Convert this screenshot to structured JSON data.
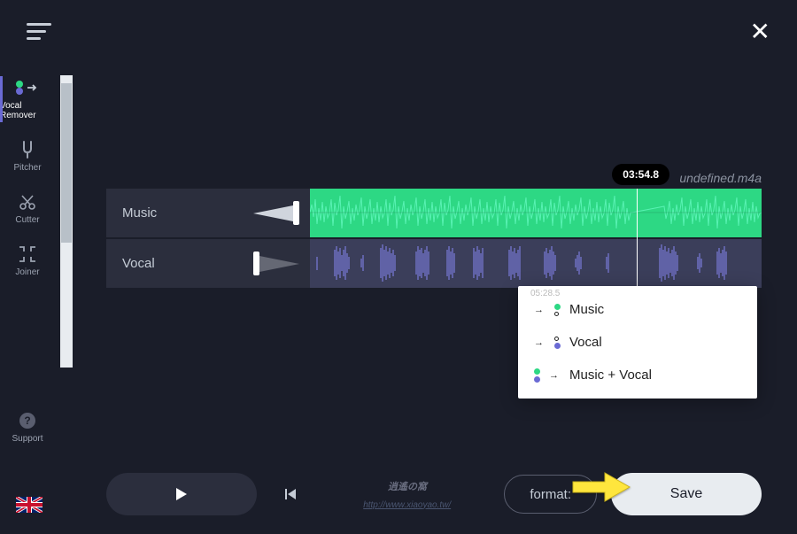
{
  "header": {
    "close_label": "✕"
  },
  "sidebar": {
    "items": [
      {
        "label": "Vocal Remover"
      },
      {
        "label": "Pitcher"
      },
      {
        "label": "Cutter"
      },
      {
        "label": "Joiner"
      }
    ],
    "support_label": "Support"
  },
  "tracks": {
    "music_label": "Music",
    "vocal_label": "Vocal"
  },
  "playback": {
    "current_time": "03:54.8",
    "filename": "undefined.m4a"
  },
  "dropdown": {
    "time_hint": "05:28.5",
    "items": [
      {
        "label": "Music"
      },
      {
        "label": "Vocal"
      },
      {
        "label": "Music + Vocal"
      }
    ]
  },
  "controls": {
    "format_label": "format:",
    "save_label": "Save"
  },
  "watermark": {
    "url": "http://www.xiaoyao.tw/"
  }
}
